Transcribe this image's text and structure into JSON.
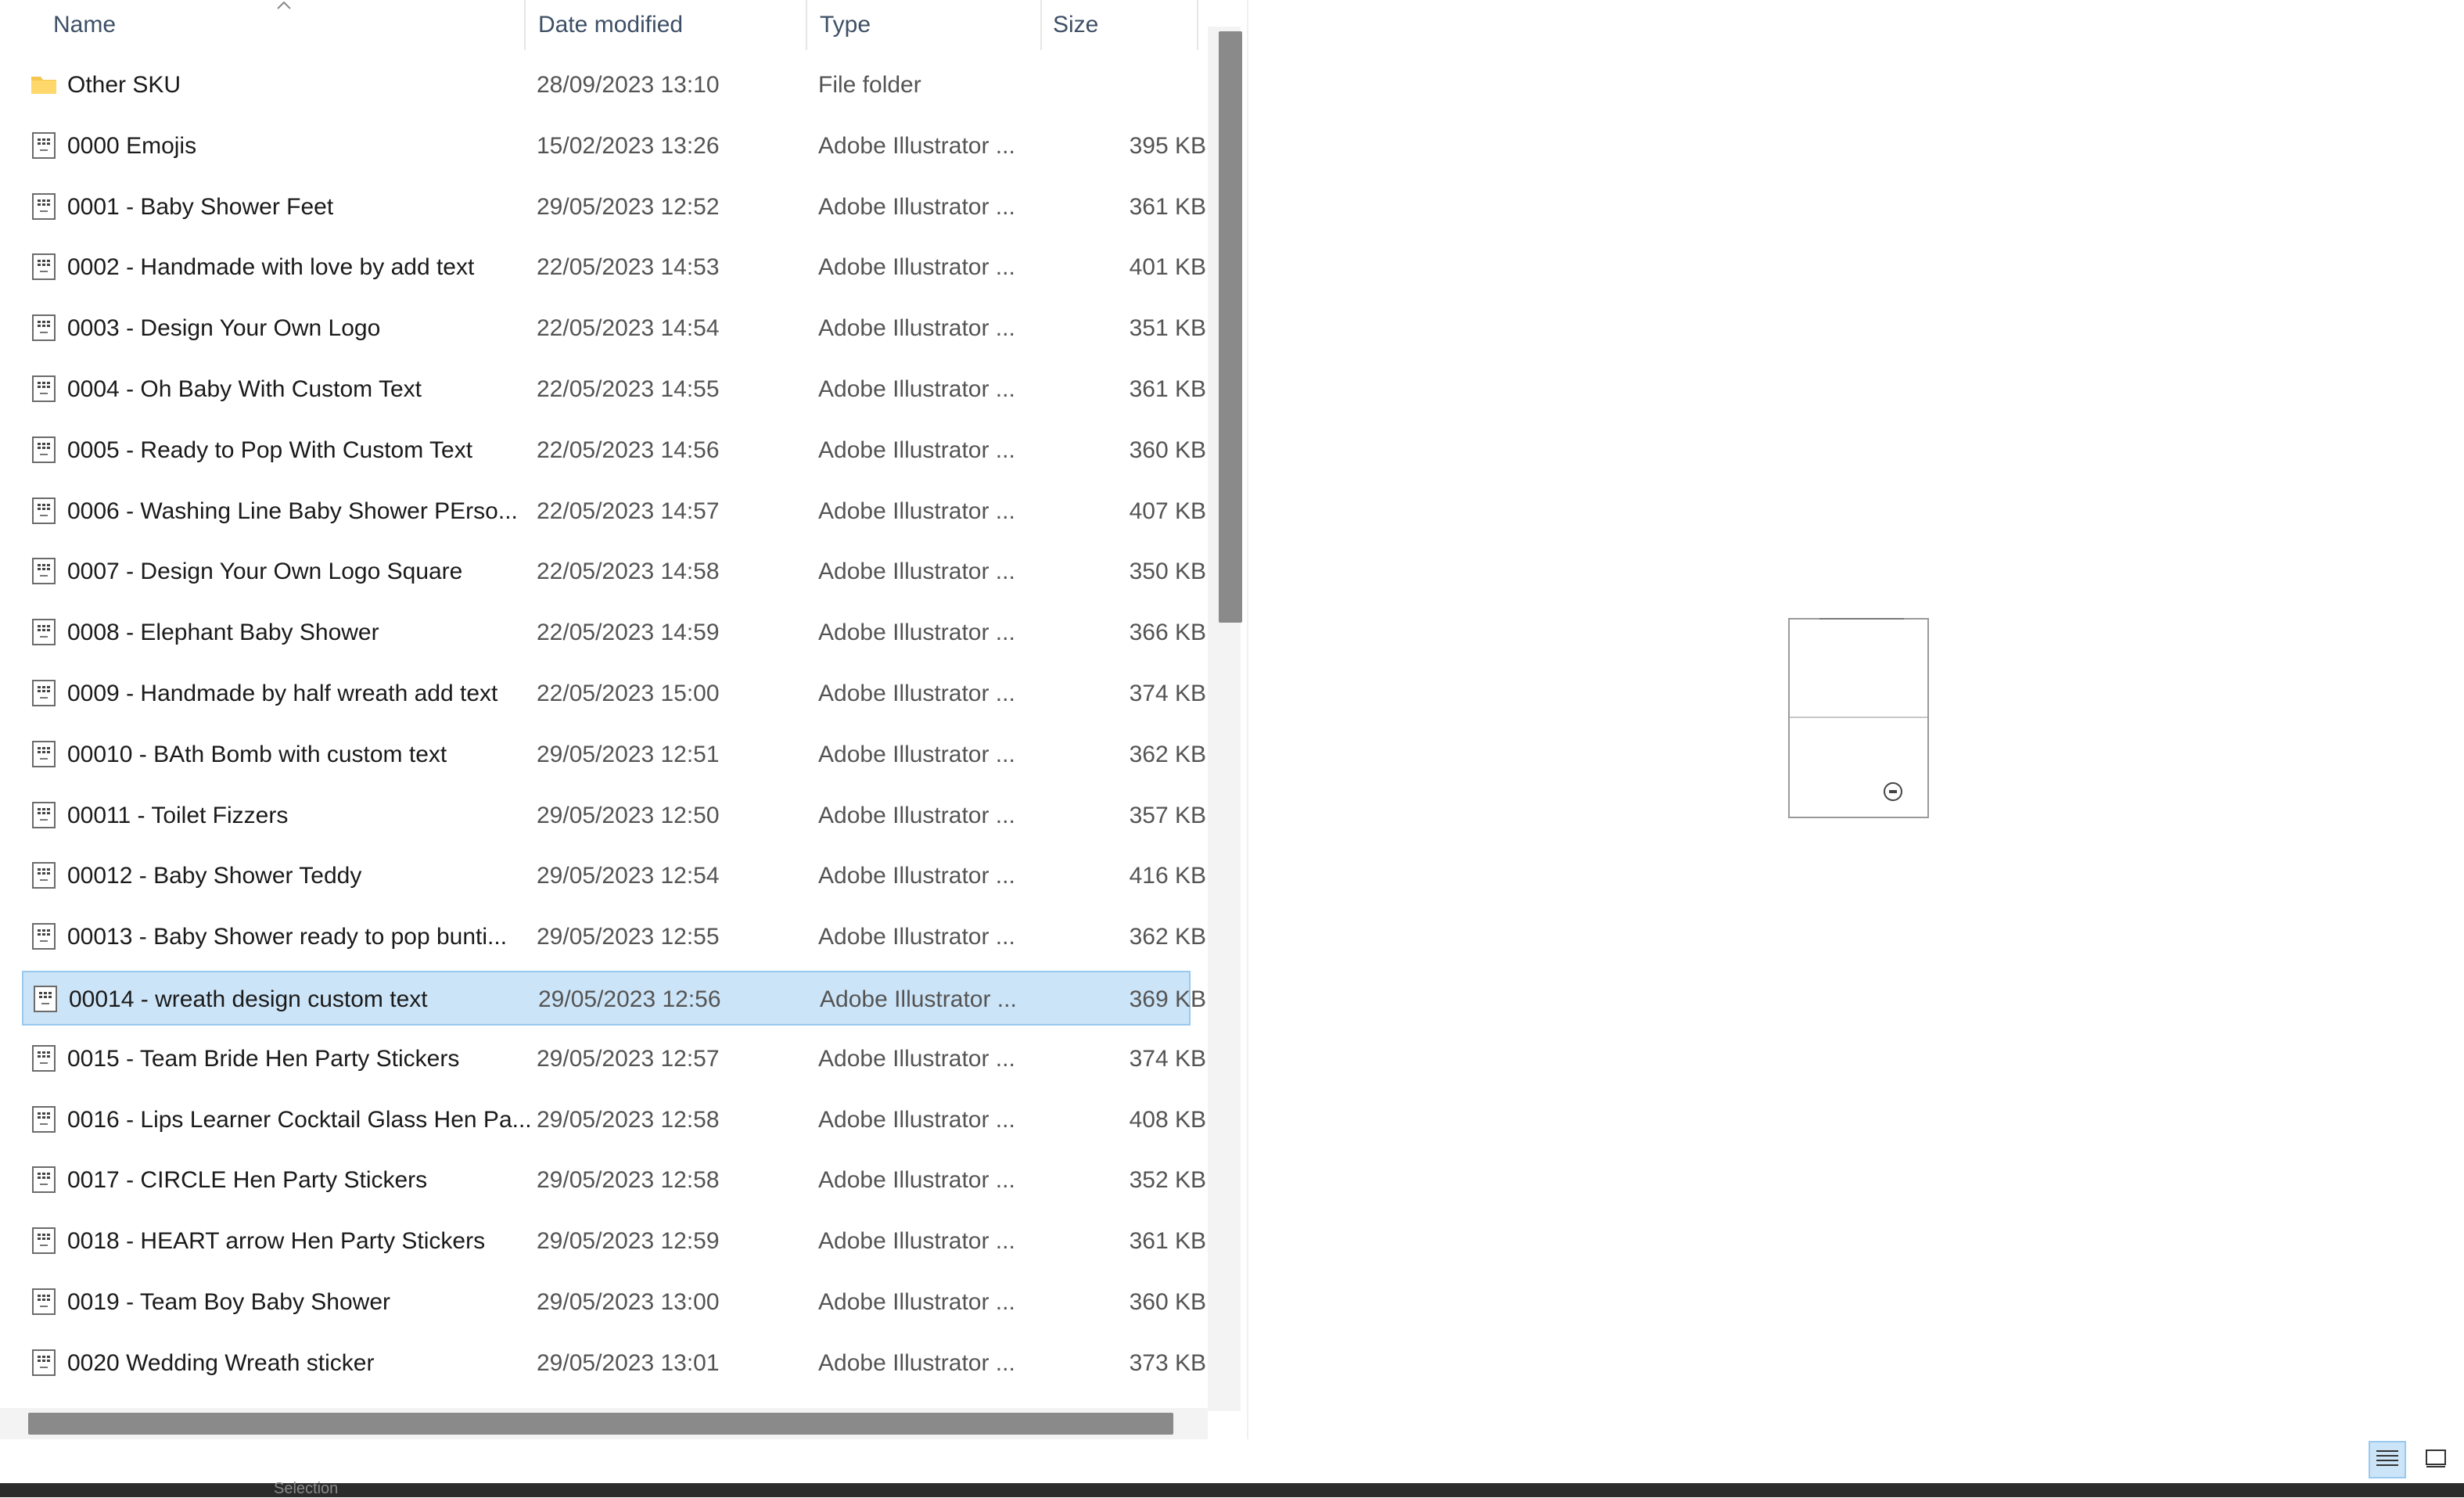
{
  "columns": {
    "name": "Name",
    "date": "Date modified",
    "type": "Type",
    "size": "Size"
  },
  "sort": {
    "column": "name",
    "direction": "ascending",
    "icon": "sort-ascending-icon"
  },
  "files": [
    {
      "name": "Other SKU",
      "date": "28/09/2023 13:10",
      "type": "File folder",
      "size": "",
      "icon": "folder-icon",
      "selected": false
    },
    {
      "name": "0000 Emojis",
      "date": "15/02/2023 13:26",
      "type": "Adobe Illustrator ...",
      "size": "395 KB",
      "icon": "illustrator-file-icon",
      "selected": false
    },
    {
      "name": "0001 - Baby Shower Feet",
      "date": "29/05/2023 12:52",
      "type": "Adobe Illustrator ...",
      "size": "361 KB",
      "icon": "illustrator-file-icon",
      "selected": false
    },
    {
      "name": "0002 - Handmade with love by add text",
      "date": "22/05/2023 14:53",
      "type": "Adobe Illustrator ...",
      "size": "401 KB",
      "icon": "illustrator-file-icon",
      "selected": false
    },
    {
      "name": "0003 - Design Your Own Logo",
      "date": "22/05/2023 14:54",
      "type": "Adobe Illustrator ...",
      "size": "351 KB",
      "icon": "illustrator-file-icon",
      "selected": false
    },
    {
      "name": "0004 - Oh Baby With Custom Text",
      "date": "22/05/2023 14:55",
      "type": "Adobe Illustrator ...",
      "size": "361 KB",
      "icon": "illustrator-file-icon",
      "selected": false
    },
    {
      "name": "0005 - Ready to Pop With Custom Text",
      "date": "22/05/2023 14:56",
      "type": "Adobe Illustrator ...",
      "size": "360 KB",
      "icon": "illustrator-file-icon",
      "selected": false
    },
    {
      "name": "0006 - Washing Line Baby Shower PErso...",
      "date": "22/05/2023 14:57",
      "type": "Adobe Illustrator ...",
      "size": "407 KB",
      "icon": "illustrator-file-icon",
      "selected": false
    },
    {
      "name": "0007 - Design Your Own Logo Square",
      "date": "22/05/2023 14:58",
      "type": "Adobe Illustrator ...",
      "size": "350 KB",
      "icon": "illustrator-file-icon",
      "selected": false
    },
    {
      "name": "0008 - Elephant Baby Shower",
      "date": "22/05/2023 14:59",
      "type": "Adobe Illustrator ...",
      "size": "366 KB",
      "icon": "illustrator-file-icon",
      "selected": false
    },
    {
      "name": "0009 - Handmade by half wreath add text",
      "date": "22/05/2023 15:00",
      "type": "Adobe Illustrator ...",
      "size": "374 KB",
      "icon": "illustrator-file-icon",
      "selected": false
    },
    {
      "name": "00010 - BAth Bomb with custom text",
      "date": "29/05/2023 12:51",
      "type": "Adobe Illustrator ...",
      "size": "362 KB",
      "icon": "illustrator-file-icon",
      "selected": false
    },
    {
      "name": "00011 - Toilet Fizzers",
      "date": "29/05/2023 12:50",
      "type": "Adobe Illustrator ...",
      "size": "357 KB",
      "icon": "illustrator-file-icon",
      "selected": false
    },
    {
      "name": "00012 - Baby Shower Teddy",
      "date": "29/05/2023 12:54",
      "type": "Adobe Illustrator ...",
      "size": "416 KB",
      "icon": "illustrator-file-icon",
      "selected": false
    },
    {
      "name": "00013 - Baby Shower ready to pop bunti...",
      "date": "29/05/2023 12:55",
      "type": "Adobe Illustrator ...",
      "size": "362 KB",
      "icon": "illustrator-file-icon",
      "selected": false
    },
    {
      "name": "00014 - wreath design custom text",
      "date": "29/05/2023 12:56",
      "type": "Adobe Illustrator ...",
      "size": "369 KB",
      "icon": "illustrator-file-icon",
      "selected": true
    },
    {
      "name": "0015 - Team Bride Hen Party Stickers",
      "date": "29/05/2023 12:57",
      "type": "Adobe Illustrator ...",
      "size": "374 KB",
      "icon": "illustrator-file-icon",
      "selected": false
    },
    {
      "name": "0016 - Lips Learner Cocktail Glass Hen Pa...",
      "date": "29/05/2023 12:58",
      "type": "Adobe Illustrator ...",
      "size": "408 KB",
      "icon": "illustrator-file-icon",
      "selected": false
    },
    {
      "name": "0017 -  CIRCLE Hen Party Stickers",
      "date": "29/05/2023 12:58",
      "type": "Adobe Illustrator ...",
      "size": "352 KB",
      "icon": "illustrator-file-icon",
      "selected": false
    },
    {
      "name": "0018 -  HEART arrow Hen Party Stickers",
      "date": "29/05/2023 12:59",
      "type": "Adobe Illustrator ...",
      "size": "361 KB",
      "icon": "illustrator-file-icon",
      "selected": false
    },
    {
      "name": "0019 -  Team Boy Baby Shower",
      "date": "29/05/2023 13:00",
      "type": "Adobe Illustrator ...",
      "size": "360 KB",
      "icon": "illustrator-file-icon",
      "selected": false
    },
    {
      "name": "0020 Wedding Wreath sticker",
      "date": "29/05/2023 13:01",
      "type": "Adobe Illustrator ...",
      "size": "373 KB",
      "icon": "illustrator-file-icon",
      "selected": false
    }
  ],
  "preview": {
    "icon": "document-preview-icon"
  },
  "view_buttons": [
    {
      "icon": "details-view-icon",
      "active": true
    },
    {
      "icon": "large-icons-view-icon",
      "active": false
    }
  ],
  "bottom_strip": {
    "text": "Selection"
  },
  "colors": {
    "selection_bg": "#cce4f7",
    "selection_border": "#99c9ef",
    "folder": "#f4c64f",
    "scroll_thumb": "#8a8a8a"
  }
}
